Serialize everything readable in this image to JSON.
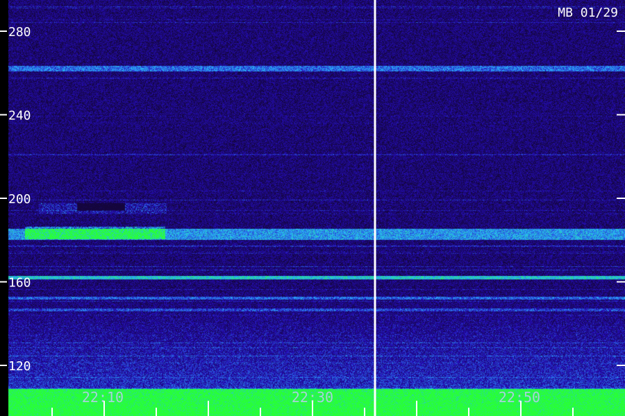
{
  "chart_data": {
    "type": "heatmap",
    "title": "MB 01/29",
    "y_ticks": [
      "280",
      "240",
      "200",
      "160",
      "120"
    ],
    "y_tick_values": [
      280,
      240,
      200,
      160,
      120
    ],
    "x_ticks": [
      "22:10",
      "22:30",
      "22:50"
    ],
    "colors": {
      "background": "#1a0a66",
      "low": "#10065a",
      "mid": "#2a2acc",
      "high": "#3aa0ff",
      "peak": "#40ff60",
      "marker_line": "#ffffff"
    }
  }
}
